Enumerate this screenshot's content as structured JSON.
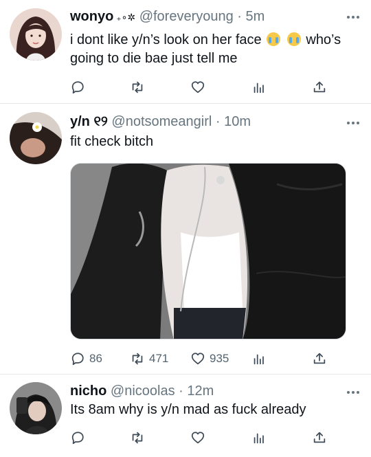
{
  "tweets": [
    {
      "name": "wonyo",
      "name_suffix": " ₊∘✲",
      "handle": "@foreveryoung",
      "separator": " · ",
      "time": "5m",
      "text_line1_a": "i dont like y/n’s look on her face ",
      "text_line1_b": "  who’s",
      "text_line2": "going to die bae just tell me",
      "emoji": "loudly-crying-face-emoji",
      "counts": {
        "replies": "",
        "retweets": "",
        "likes": ""
      }
    },
    {
      "name": "y/n",
      "name_suffix": " ୧୨",
      "handle": "@notsomeangirl",
      "separator": " · ",
      "time": "10m",
      "text": "fit check bitch",
      "counts": {
        "replies": "86",
        "retweets": "471",
        "likes": "935"
      }
    },
    {
      "name": "nicho",
      "name_suffix": "",
      "handle": "@nicoolas",
      "separator": " · ",
      "time": "12m",
      "text": "Its 8am why is y/n mad as fuck already",
      "counts": {
        "replies": "",
        "retweets": "",
        "likes": ""
      }
    }
  ],
  "icons": [
    "reply-icon",
    "retweet-icon",
    "like-icon",
    "analytics-icon",
    "share-icon",
    "more-icon"
  ],
  "colors": {
    "text": "#0f1419",
    "secondary": "#66757f",
    "divider": "#e6e9eb"
  }
}
